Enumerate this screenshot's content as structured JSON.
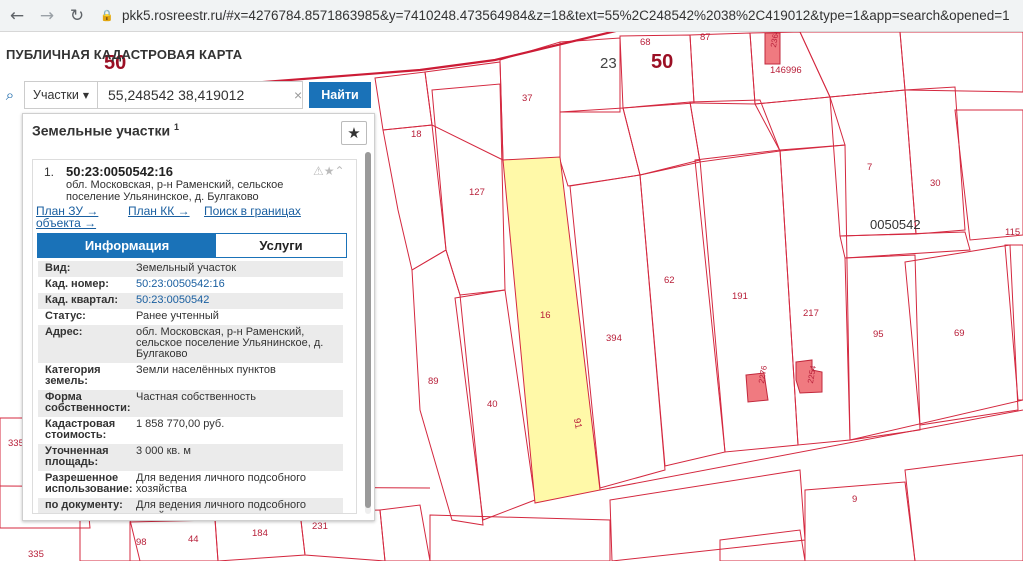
{
  "browser": {
    "url": "pkk5.rosreestr.ru/#x=4276784.8571863985&y=7410248.473564984&z=18&text=55%2C248542%2038%2C419012&type=1&app=search&opened=1",
    "back_icon": "arrow-left-icon",
    "forward_icon": "arrow-right-icon",
    "reload_icon": "reload-icon"
  },
  "app": {
    "title": "ПУБЛИЧНАЯ КАДАСТРОВАЯ КАРТА"
  },
  "search": {
    "type_label": "Участки",
    "value": "55,248542 38,419012",
    "button_label": "Найти"
  },
  "panel": {
    "title": "Земельные участки",
    "count": "1",
    "result": {
      "index": "1.",
      "cad_number": "50:23:0050542:16",
      "address": "обл. Московская, р-н Раменский, сельское поселение Ульянинское, д. Булгаково",
      "links": [
        "План ЗУ →",
        "План КК →",
        "Поиск в границах",
        "объекта →"
      ],
      "tabs": [
        "Информация",
        "Услуги"
      ],
      "attributes": [
        {
          "label": "Вид:",
          "value": "Земельный участок"
        },
        {
          "label": "Кад. номер:",
          "value": "50:23:0050542:16"
        },
        {
          "label": "Кад. квартал:",
          "value": "50:23:0050542"
        },
        {
          "label": "Статус:",
          "value": "Ранее учтенный"
        },
        {
          "label": "Адрес:",
          "value": "обл. Московская, р-н Раменский, сельское поселение Ульянинское, д. Булгаково"
        },
        {
          "label": "Категория земель:",
          "value": "Земли населённых пунктов"
        },
        {
          "label": "Форма собственности:",
          "value": "Частная собственность"
        },
        {
          "label": "Кадастровая стоимость:",
          "value": "1 858 770,00 руб."
        },
        {
          "label": "Уточненная площадь:",
          "value": "3 000 кв. м"
        },
        {
          "label": "Разрешенное использование:",
          "value": "Для ведения личного подсобного хозяйства"
        },
        {
          "label": "по документу:",
          "value": "Для ведения личного подсобного хозяйства"
        }
      ]
    }
  },
  "map": {
    "district_label_1": "50",
    "district_label_2": "50",
    "district_label_3": "23",
    "quarter_label": "0050542",
    "plot_labels": [
      "37",
      "68",
      "87",
      "2364",
      "146996",
      "18",
      "127",
      "7",
      "30",
      "115",
      "62",
      "191",
      "217",
      "95",
      "69",
      "16",
      "394",
      "89",
      "40",
      "91",
      "335",
      "98",
      "44",
      "184",
      "231",
      "335",
      "9",
      "2276",
      "2254"
    ],
    "colors": {
      "boundary": "#d4283f",
      "selected_fill": "#fff9a8",
      "building": "#f07a80"
    }
  }
}
